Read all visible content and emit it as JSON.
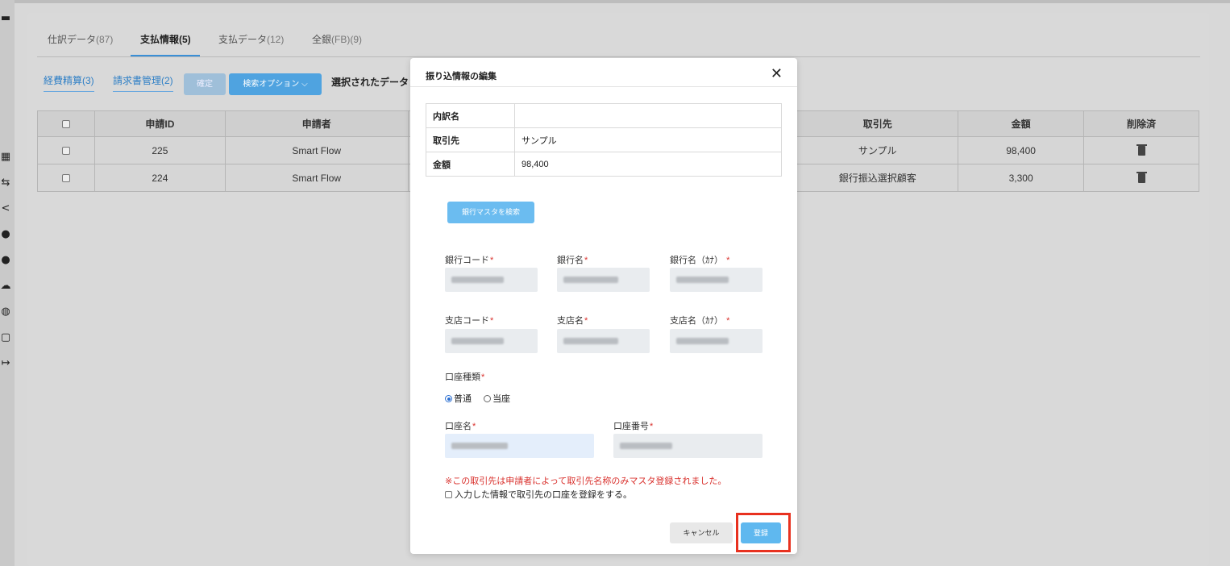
{
  "tabs": [
    {
      "label": "仕訳データ",
      "count": "(87)"
    },
    {
      "label": "支払情報",
      "count": "(5)"
    },
    {
      "label": "支払データ",
      "count": "(12)"
    },
    {
      "label": "全銀",
      "count": "(FB)(9)"
    }
  ],
  "subtabs": [
    "経費精算(3)",
    "請求書管理(2)"
  ],
  "toolbar": {
    "confirm_label": "確定",
    "search_option_label": "検索オプション ⌵",
    "selected_label": "選択されたデータ："
  },
  "table": {
    "headers": [
      "",
      "申請ID",
      "申請者",
      "",
      "取引先",
      "金額",
      "削除済"
    ],
    "rows": [
      {
        "id": "225",
        "applicant": "Smart Flow",
        "partner": "サンプル",
        "amount": "98,400"
      },
      {
        "id": "224",
        "applicant": "Smart Flow",
        "partner": "銀行振込選択顧客",
        "amount": "3,300"
      }
    ]
  },
  "modal": {
    "title": "振り込情報の編集",
    "close_glyph": "✕",
    "info": [
      {
        "key": "内訳名",
        "value": ""
      },
      {
        "key": "取引先",
        "value": "サンプル"
      },
      {
        "key": "金額",
        "value": "98,400"
      }
    ],
    "bank_search_label": "銀行マスタを検索",
    "fields": {
      "bank_code": "銀行コード",
      "bank_name": "銀行名",
      "bank_name_kana": "銀行名（ｶﾅ）",
      "branch_code": "支店コード",
      "branch_name": "支店名",
      "branch_name_kana": "支店名（ｶﾅ）",
      "account_type": "口座種類",
      "account_name": "口座名",
      "account_number": "口座番号"
    },
    "required_mark": "*",
    "account_types": [
      {
        "label": "普通",
        "selected": true
      },
      {
        "label": "当座",
        "selected": false
      }
    ],
    "notice": "※この取引先は申請者によって取引先名称のみマスタ登録されました。",
    "checkbox_label": "入力した情報で取引先の口座を登録をする。",
    "cancel_label": "キャンセル",
    "register_label": "登録"
  },
  "colors": {
    "accent": "#3a8fd6",
    "primary_button": "#5fb8ef",
    "required": "#d9302c",
    "highlight": "#e8311f"
  },
  "icons": [
    "wallet-icon",
    "grid-icon",
    "transfer-icon",
    "share-icon",
    "user-edit-icon",
    "users-icon",
    "cloud-upload-icon",
    "globe-icon",
    "lock-icon",
    "logout-icon"
  ]
}
